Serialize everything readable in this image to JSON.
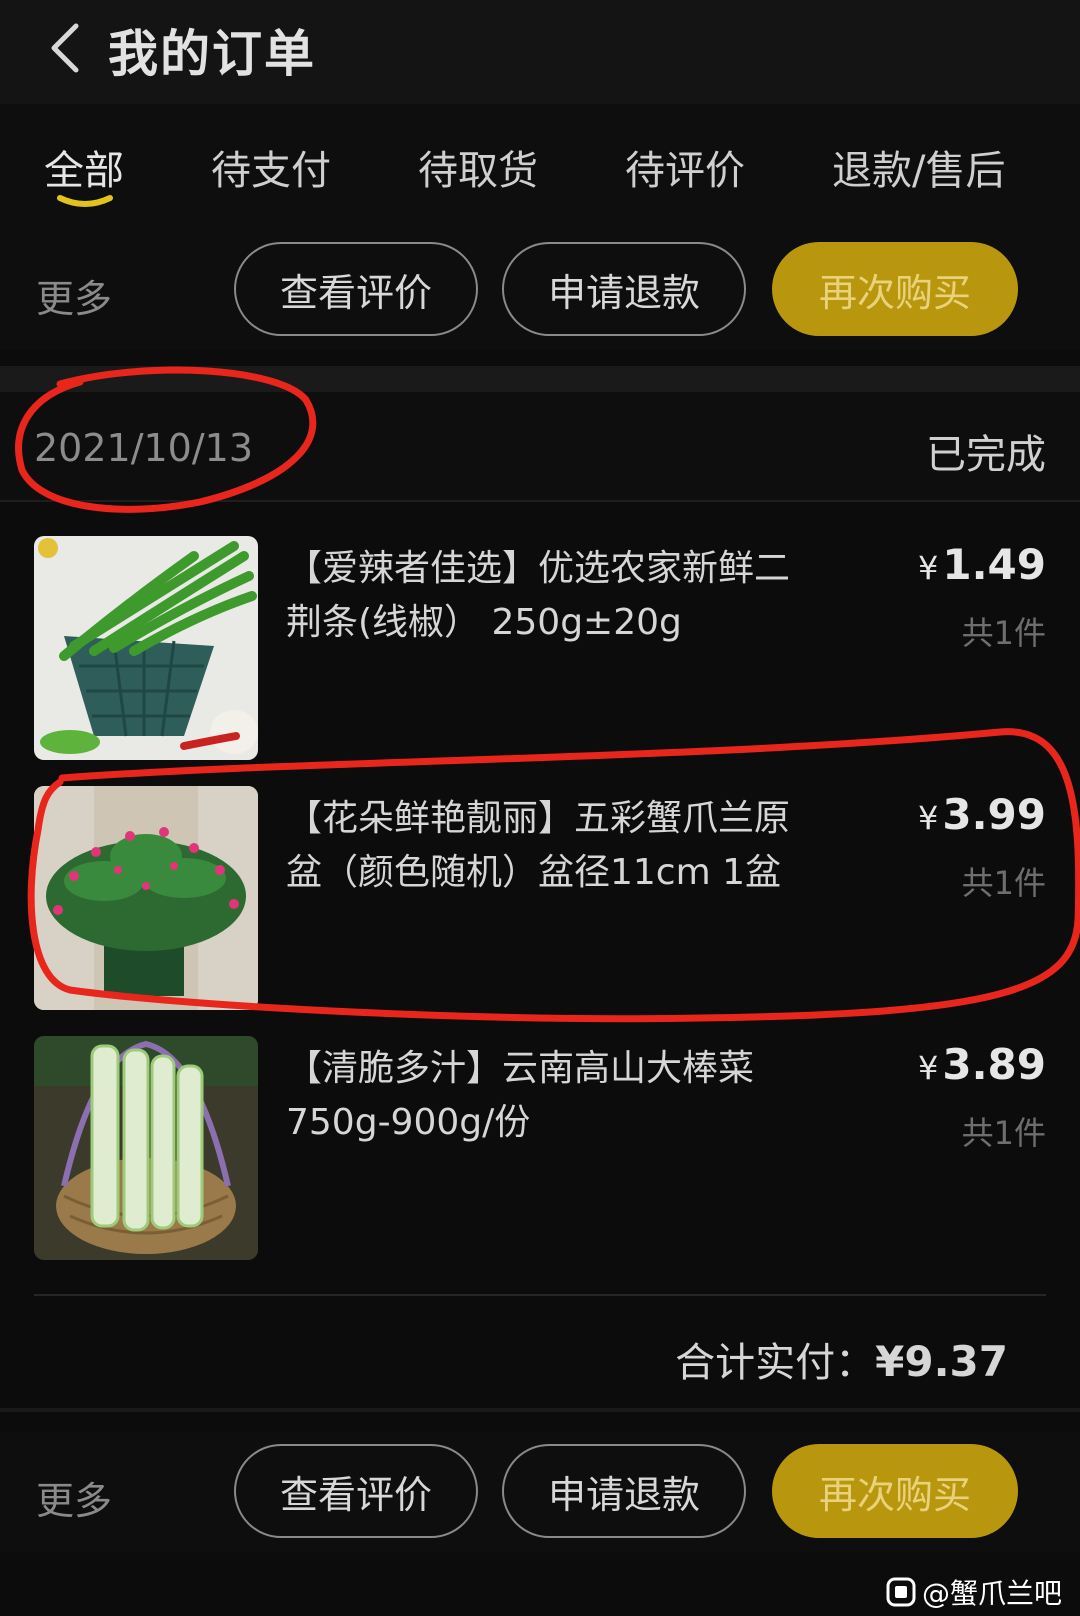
{
  "header": {
    "title": "我的订单"
  },
  "tabs": [
    {
      "label": "全部",
      "active": true
    },
    {
      "label": "待支付"
    },
    {
      "label": "待取货"
    },
    {
      "label": "待评价"
    },
    {
      "label": "退款/售后"
    }
  ],
  "actions": {
    "more": "更多",
    "view_review": "查看评价",
    "refund": "申请退款",
    "buy_again": "再次购买"
  },
  "order": {
    "date": "2021/10/13",
    "status": "已完成",
    "items": [
      {
        "title": "【爱辣者佳选】优选农家新鲜二荆条(线椒） 250g±20g",
        "currency": "¥",
        "price": "1.49",
        "qty": "共1件",
        "image": "green-chili-icon"
      },
      {
        "title": "【花朵鲜艳靓丽】五彩蟹爪兰原盆（颜色随机）盆径11cm 1盆",
        "currency": "¥",
        "price": "3.99",
        "qty": "共1件",
        "image": "cactus-plant-icon"
      },
      {
        "title": "【清脆多汁】云南高山大棒菜750g-900g/份",
        "currency": "¥",
        "price": "3.89",
        "qty": "共1件",
        "image": "celery-stalk-icon"
      }
    ],
    "total_label": "合计实付：",
    "total_currency": "¥",
    "total_amount": "9.37"
  },
  "bottom_actions": {
    "more": "更多",
    "view_review": "查看评价",
    "refund": "申请退款",
    "buy_again": "再次购买"
  },
  "watermark": "@蟹爪兰吧",
  "colors": {
    "accent": "#b8970f",
    "annotation": "#e8261c",
    "underline": "#e0c31c"
  }
}
